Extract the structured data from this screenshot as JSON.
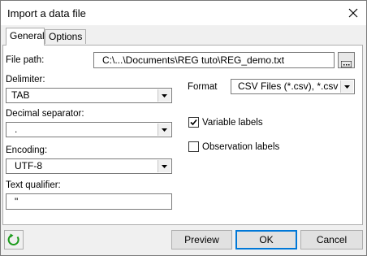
{
  "window": {
    "title": "Import a data file"
  },
  "tabs": [
    {
      "label": "General",
      "active": true
    },
    {
      "label": "Options",
      "active": false
    }
  ],
  "general": {
    "file_path": {
      "label": "File path:",
      "value": "C:\\...\\Documents\\REG tuto\\REG_demo.txt"
    },
    "delimiter": {
      "label": "Delimiter:",
      "value": "TAB"
    },
    "decimal_separator": {
      "label": "Decimal separator:",
      "value": "."
    },
    "encoding": {
      "label": "Encoding:",
      "value": "UTF-8"
    },
    "text_qualifier": {
      "label": "Text qualifier:",
      "value": "\""
    },
    "format": {
      "label": "Format",
      "value": "CSV Files (*.csv), *.csv"
    },
    "variable_labels": {
      "label": "Variable labels",
      "checked": true
    },
    "observation_labels": {
      "label": "Observation labels",
      "checked": false
    }
  },
  "footer": {
    "preview_label": "Preview",
    "ok_label": "OK",
    "cancel_label": "Cancel"
  },
  "icons": {
    "close": "close-icon",
    "browse": "browse-icon",
    "dropdown": "chevron-down-icon",
    "refresh": "refresh-icon"
  },
  "colors": {
    "accent": "#0078d7",
    "refresh_icon": "#1a9a1a"
  }
}
